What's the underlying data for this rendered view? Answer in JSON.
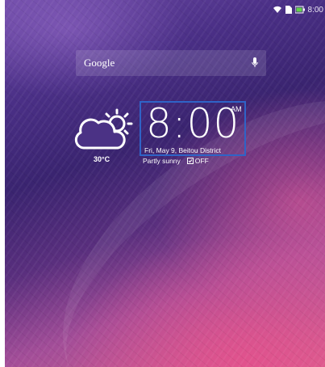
{
  "status_bar": {
    "time": "8:00",
    "icons": [
      "wifi-icon",
      "sim-card-icon",
      "battery-icon"
    ]
  },
  "search": {
    "label": "Google",
    "icon": "microphone-icon"
  },
  "weather": {
    "icon": "partly-cloudy-icon",
    "temperature": "30°C",
    "condition": "Partly sunny"
  },
  "clock": {
    "time": "8:00",
    "ampm": "AM",
    "date_location": "Fri, May 9, Beitou District",
    "alarm_status": "OFF",
    "highlight_color": "#2f63c7"
  }
}
